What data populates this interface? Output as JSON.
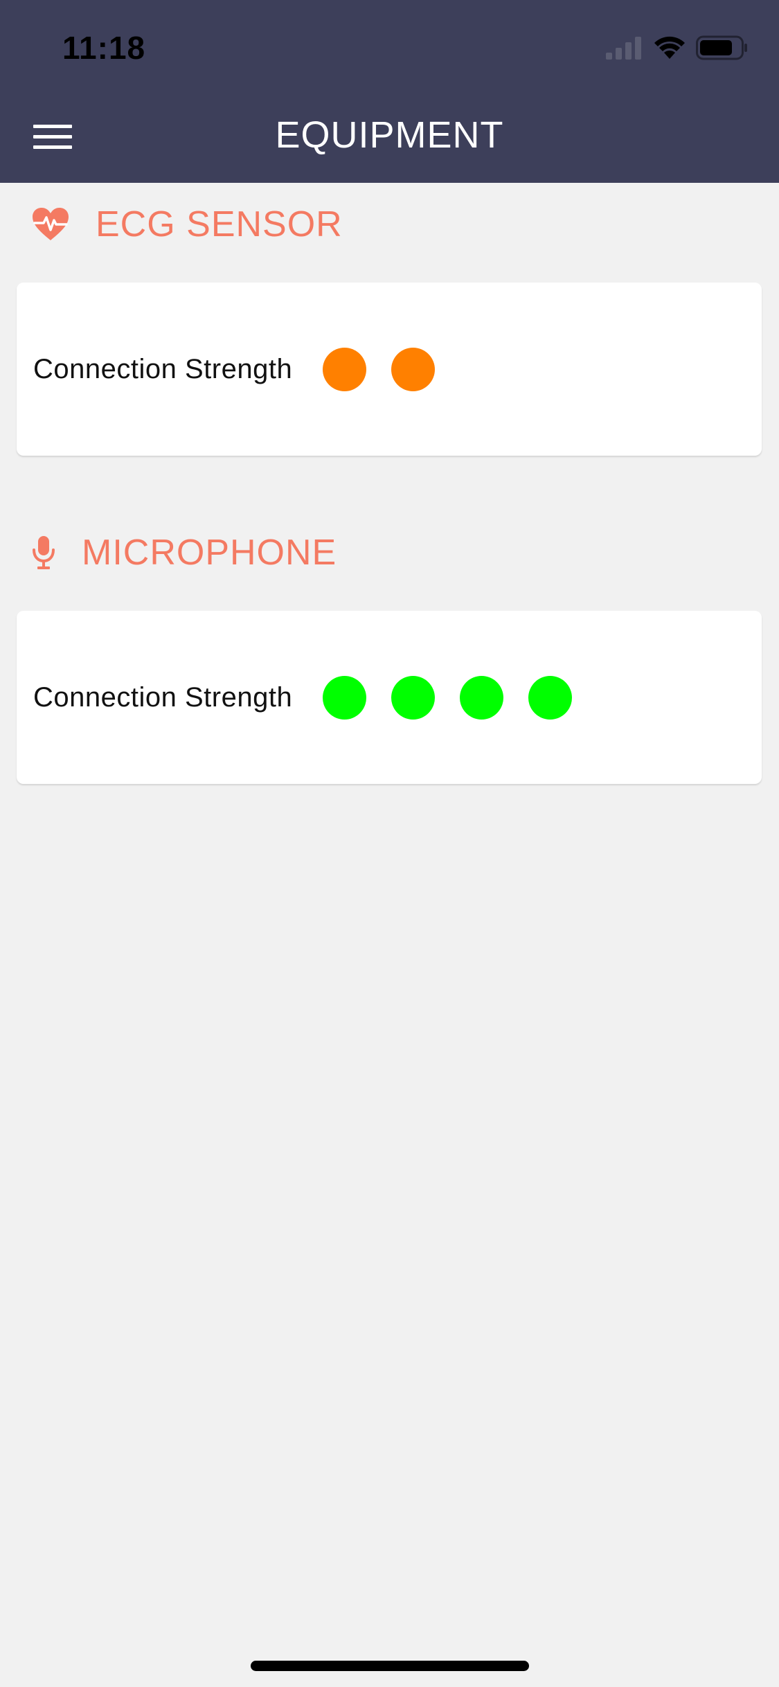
{
  "status_bar": {
    "time": "11:18"
  },
  "nav": {
    "title": "EQUIPMENT",
    "menu_icon": "hamburger-menu-icon"
  },
  "sections": [
    {
      "title": "ECG SENSOR",
      "icon": "heart-pulse-icon",
      "row_label": "Connection Strength",
      "strength": 2,
      "dot_color": "#ff8000"
    },
    {
      "title": "MICROPHONE",
      "icon": "microphone-icon",
      "row_label": "Connection Strength",
      "strength": 4,
      "dot_color": "#00ff00"
    }
  ],
  "colors": {
    "header_bg": "#3d3f5a",
    "accent": "#f47a62",
    "page_bg": "#f1f1f1"
  }
}
